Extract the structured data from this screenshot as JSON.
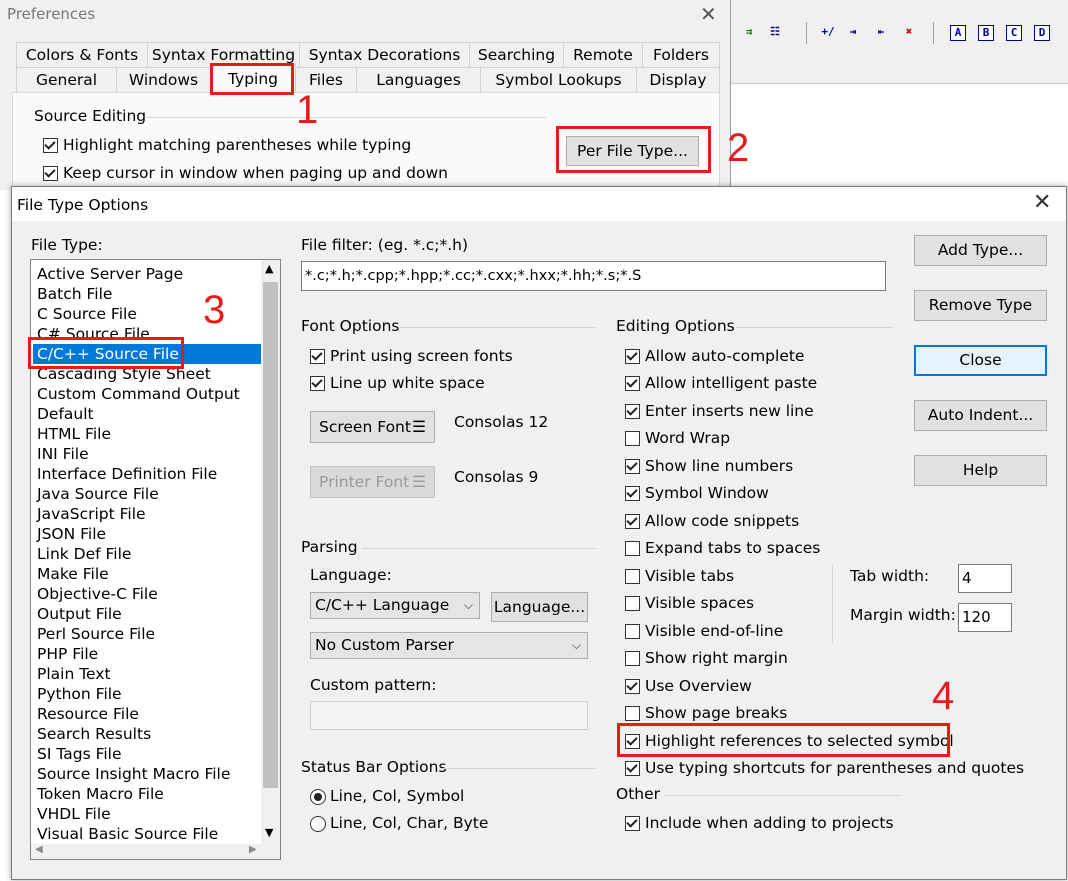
{
  "preferences": {
    "title": "Preferences",
    "tabs_row1": [
      "Colors & Fonts",
      "Syntax Formatting",
      "Syntax Decorations",
      "Searching",
      "Remote",
      "Folders"
    ],
    "tabs_row2": [
      "General",
      "Windows",
      "Typing",
      "Files",
      "Languages",
      "Symbol Lookups",
      "Display"
    ],
    "active_tab": "Typing",
    "source_editing_group": "Source Editing",
    "highlight_parens": "Highlight matching parentheses while typing",
    "keep_cursor": "Keep cursor in window when paging up and down",
    "per_file_type_button": "Per File Type..."
  },
  "toolbar": {
    "icons": [
      "merge-icon",
      "list-icon",
      "plus-minus-icon",
      "indent-icon",
      "outdent-icon",
      "delete-icon",
      "A-icon",
      "B-icon",
      "C-icon",
      "D-icon"
    ],
    "labels": {
      "plus_minus": "+/",
      "box_a": "A",
      "box_b": "B",
      "box_c": "C",
      "box_d": "D"
    }
  },
  "annotations": {
    "step1": "1",
    "step2": "2",
    "step3": "3",
    "step4": "4",
    "color": "#e81b1b"
  },
  "file_type_options": {
    "title": "File Type Options",
    "file_type_label": "File Type:",
    "file_types": [
      "Active Server Page",
      "Batch File",
      "C Source File",
      "C# Source File",
      "C/C++ Source File",
      "Cascading Style Sheet",
      "Custom Command Output",
      "Default",
      "HTML File",
      "INI File",
      "Interface Definition File",
      "Java Source File",
      "JavaScript File",
      "JSON File",
      "Link Def File",
      "Make File",
      "Objective-C File",
      "Output File",
      "Perl Source File",
      "PHP File",
      "Plain Text",
      "Python File",
      "Resource File",
      "Search Results",
      "SI Tags File",
      "Source Insight Macro File",
      "Token Macro File",
      "VHDL File",
      "Visual Basic Source File"
    ],
    "selected_file_type": "C/C++ Source File",
    "file_filter_label": "File filter: (eg. *.c;*.h)",
    "file_filter_value": "*.c;*.h;*.cpp;*.hpp;*.cc;*.cxx;*.hxx;*.hh;*.s;*.S",
    "font_options": {
      "group": "Font Options",
      "print_screen_fonts": "Print using screen fonts",
      "line_up_white_space": "Line up white space",
      "screen_font_button": "Screen Font",
      "screen_font_value": "Consolas 12",
      "printer_font_button": "Printer Font",
      "printer_font_value": "Consolas 9",
      "menu_glyph": "☰"
    },
    "parsing": {
      "group": "Parsing",
      "language_label": "Language:",
      "language_value": "C/C++ Language",
      "language_button": "Language...",
      "parser_value": "No Custom Parser",
      "custom_pattern_label": "Custom pattern:",
      "custom_pattern_value": ""
    },
    "status_bar": {
      "group": "Status Bar Options",
      "option1": "Line, Col, Symbol",
      "option2": "Line, Col, Char, Byte",
      "selected": "Line, Col, Symbol"
    },
    "editing_options": {
      "group": "Editing Options",
      "items": [
        {
          "label": "Allow auto-complete",
          "checked": true
        },
        {
          "label": "Allow intelligent paste",
          "checked": true
        },
        {
          "label": "Enter inserts new line",
          "checked": true
        },
        {
          "label": "Word Wrap",
          "checked": false
        },
        {
          "label": "Show line numbers",
          "checked": true
        },
        {
          "label": "Symbol Window",
          "checked": true
        },
        {
          "label": "Allow code snippets",
          "checked": true
        },
        {
          "label": "Expand tabs to spaces",
          "checked": false
        },
        {
          "label": "Visible tabs",
          "checked": false
        },
        {
          "label": "Visible spaces",
          "checked": false
        },
        {
          "label": "Visible end-of-line",
          "checked": false
        },
        {
          "label": "Show right margin",
          "checked": false
        },
        {
          "label": "Use Overview",
          "checked": true
        },
        {
          "label": "Show page breaks",
          "checked": false
        },
        {
          "label": "Highlight references to selected symbol",
          "checked": true
        },
        {
          "label": "Use typing shortcuts for parentheses and quotes",
          "checked": true
        }
      ],
      "tab_width_label": "Tab width:",
      "tab_width_value": "4",
      "margin_width_label": "Margin width:",
      "margin_width_value": "120"
    },
    "other": {
      "group": "Other",
      "include_projects": "Include when adding to projects"
    },
    "buttons": {
      "add_type": "Add Type...",
      "remove_type": "Remove Type",
      "close": "Close",
      "auto_indent": "Auto Indent...",
      "help": "Help"
    }
  }
}
